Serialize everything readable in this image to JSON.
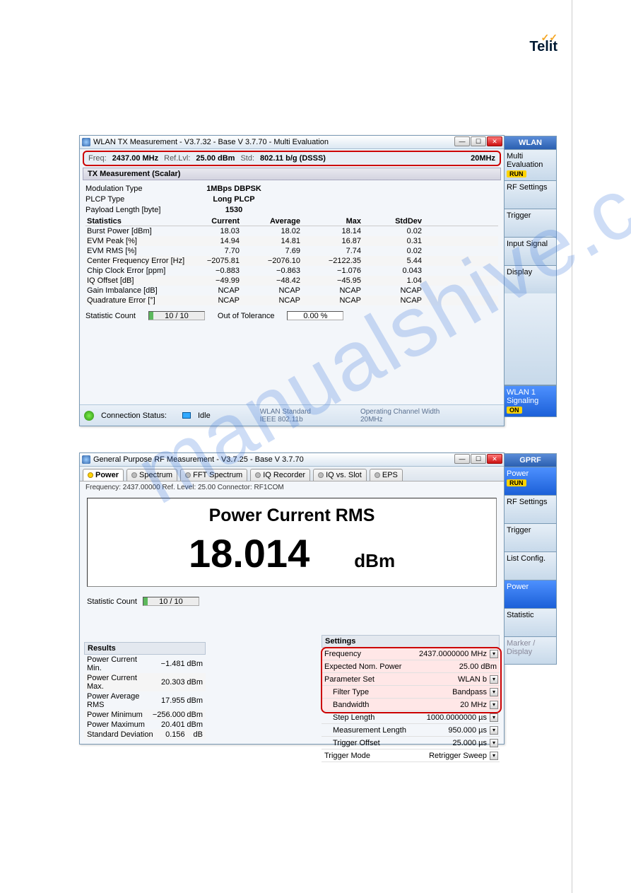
{
  "logo": "Telit",
  "win1": {
    "title": "WLAN TX Measurement  - V3.7.32 - Base V 3.7.70 - Multi Evaluation",
    "infobar": {
      "freq_lbl": "Freq:",
      "freq": "2437.00 MHz",
      "ref_lbl": "Ref.Lvl:",
      "ref": "25.00 dBm",
      "std_lbl": "Std:",
      "std": "802.11 b/g (DSSS)",
      "bw": "20MHz"
    },
    "section": "TX Measurement (Scalar)",
    "params": [
      {
        "label": "Modulation Type",
        "value": "1MBps DBPSK"
      },
      {
        "label": "PLCP Type",
        "value": "Long PLCP"
      },
      {
        "label": "Payload Length [byte]",
        "value": "1530"
      }
    ],
    "stats_hdr": {
      "label": "Statistics",
      "c1": "Current",
      "c2": "Average",
      "c3": "Max",
      "c4": "StdDev"
    },
    "stats": [
      {
        "label": "Burst Power [dBm]",
        "c": [
          "18.03",
          "18.02",
          "18.14",
          "0.02"
        ]
      },
      {
        "label": "EVM Peak [%]",
        "c": [
          "14.94",
          "14.81",
          "16.87",
          "0.31"
        ]
      },
      {
        "label": "EVM RMS [%]",
        "c": [
          "7.70",
          "7.69",
          "7.74",
          "0.02"
        ]
      },
      {
        "label": "Center Frequency Error [Hz]",
        "c": [
          "−2075.81",
          "−2076.10",
          "−2122.35",
          "5.44"
        ]
      },
      {
        "label": "Chip Clock Error [ppm]",
        "c": [
          "−0.883",
          "−0.863",
          "−1.076",
          "0.043"
        ]
      },
      {
        "label": "IQ Offset [dB]",
        "c": [
          "−49.99",
          "−48.42",
          "−45.95",
          "1.04"
        ]
      },
      {
        "label": "Gain Imbalance [dB]",
        "c": [
          "NCAP",
          "NCAP",
          "NCAP",
          "NCAP"
        ]
      },
      {
        "label": "Quadrature Error  [°]",
        "c": [
          "NCAP",
          "NCAP",
          "NCAP",
          "NCAP"
        ]
      }
    ],
    "statcount_lbl": "Statistic Count",
    "statcount": "10 / 10",
    "tol_lbl": "Out of Tolerance",
    "tol": "0.00  %",
    "footer": {
      "conn_lbl": "Connection Status:",
      "conn_val": "Idle",
      "std_lbl": "WLAN Standard",
      "std_val": "IEEE 802.11b",
      "bw_lbl": "Operating Channel Width",
      "bw_val": "20MHz"
    },
    "side": {
      "hdr": "WLAN",
      "items": [
        {
          "label": "Multi Evaluation",
          "badge": "RUN"
        },
        {
          "label": "RF Settings"
        },
        {
          "label": "Trigger"
        },
        {
          "label": "Input Signal"
        },
        {
          "label": "Display"
        }
      ],
      "bottom": {
        "label": "WLAN 1 Signaling",
        "badge": "ON",
        "sel": true
      }
    }
  },
  "win2": {
    "title": "General Purpose RF Measurement  - V3.7.25 - Base V 3.7.70",
    "tabs": [
      "Power",
      "Spectrum",
      "FFT Spectrum",
      "IQ Recorder",
      "IQ vs. Slot",
      "EPS"
    ],
    "sub": "Frequency:  2437.00000 Ref. Level:  25.00 Connector: RF1COM",
    "big_title": "Power Current RMS",
    "big_val": "18.014",
    "big_unit": "dBm",
    "statcount_lbl": "Statistic Count",
    "statcount": "10 / 10",
    "results_hdr": "Results",
    "results": [
      {
        "label": "Power Current Min.",
        "val": "−1.481",
        "unit": "dBm"
      },
      {
        "label": "Power Current Max.",
        "val": "20.303",
        "unit": "dBm"
      },
      {
        "label": "Power Average RMS",
        "val": "17.955",
        "unit": "dBm"
      },
      {
        "label": "Power Minimum",
        "val": "−256.000",
        "unit": "dBm"
      },
      {
        "label": "Power Maximum",
        "val": "20.401",
        "unit": "dBm"
      },
      {
        "label": "Standard Deviation",
        "val": "0.156",
        "unit": "dB"
      }
    ],
    "settings_hdr": "Settings",
    "settings": [
      {
        "label": "Frequency",
        "val": "2437.0000000  MHz",
        "dd": true,
        "hl": true
      },
      {
        "label": "Expected Nom. Power",
        "val": "25.00 dBm",
        "hl": true
      },
      {
        "label": "Parameter Set",
        "val": "WLAN b",
        "dd": true,
        "hl": true
      },
      {
        "label": "Filter Type",
        "val": "Bandpass",
        "dd": true,
        "indent": true,
        "hl": true
      },
      {
        "label": "Bandwidth",
        "val": "20 MHz",
        "dd": true,
        "indent": true,
        "hl": true
      },
      {
        "label": "Step Length",
        "val": "1000.0000000  µs",
        "dd": true,
        "indent": true
      },
      {
        "label": "Measurement Length",
        "val": "950.000  µs",
        "dd": true,
        "indent": true
      },
      {
        "label": "Trigger Offset",
        "val": "25.000  µs",
        "dd": true,
        "indent": true
      },
      {
        "label": "Trigger Mode",
        "val": "Retrigger Sweep",
        "dd": true
      }
    ],
    "side": {
      "hdr": "GPRF",
      "items": [
        {
          "label": "Power",
          "badge": "RUN",
          "sel": true
        },
        {
          "label": "RF Settings"
        },
        {
          "label": "Trigger"
        },
        {
          "label": "List Config."
        },
        {
          "label": "Power",
          "sel2": true
        },
        {
          "label": "Statistic"
        },
        {
          "label": "Marker / Display",
          "dim": true
        }
      ]
    }
  }
}
